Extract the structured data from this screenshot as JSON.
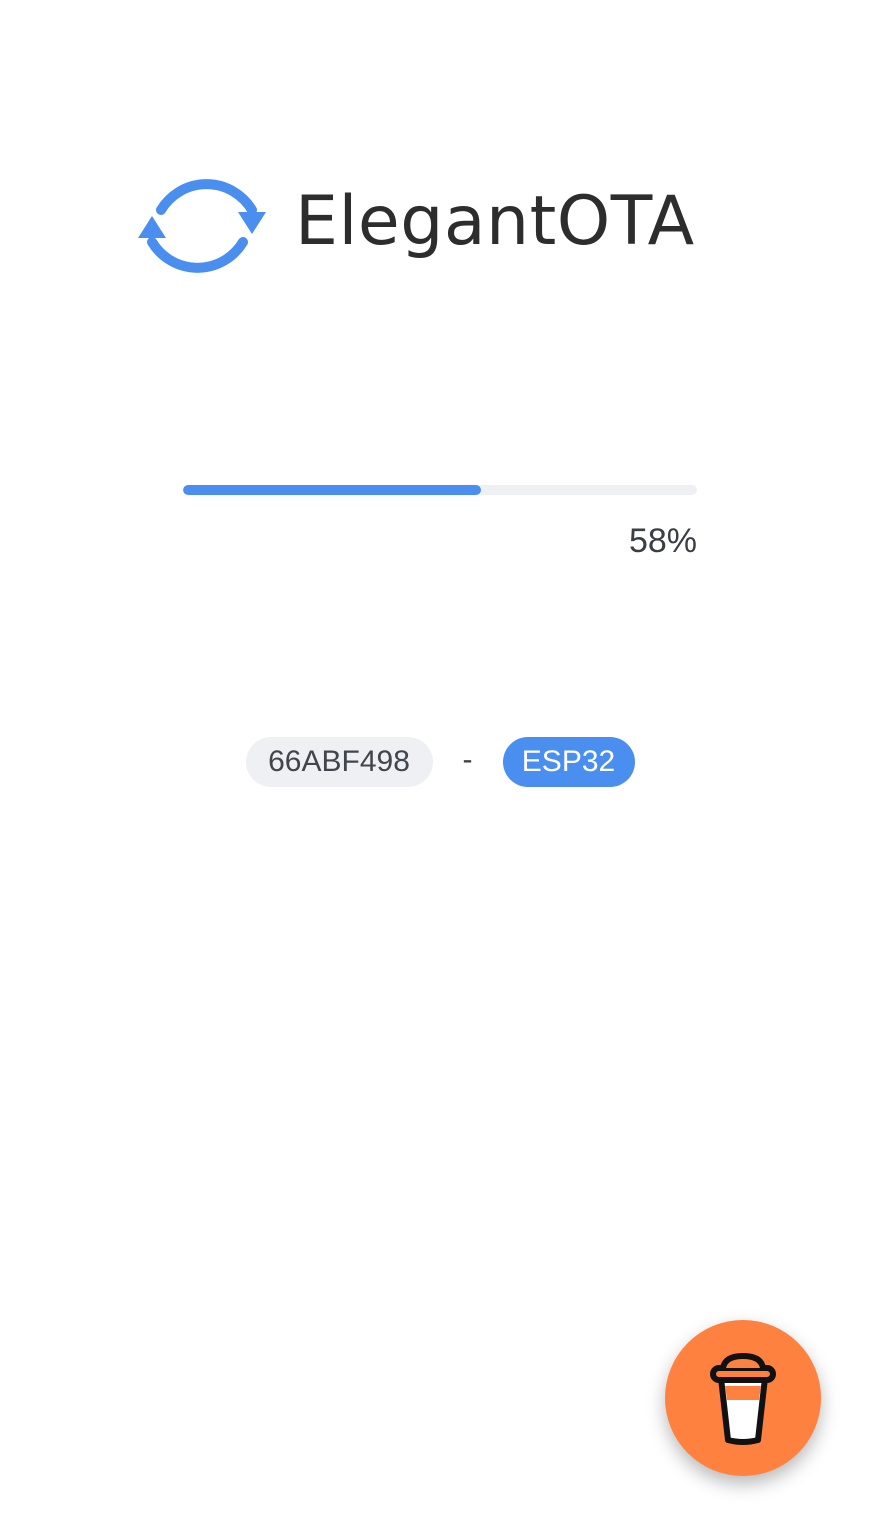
{
  "header": {
    "logo_icon": "sync-arrows-icon",
    "app_name": "ElegantOTA"
  },
  "progress": {
    "percent": 58,
    "label": "58%"
  },
  "device": {
    "id": "66ABF498",
    "separator": "-",
    "hardware": "ESP32"
  },
  "support": {
    "icon": "coffee-cup-icon"
  },
  "colors": {
    "accent": "#4a8ef0",
    "track": "#eef0f3",
    "support_button": "#ff813f",
    "text": "#2d2d2d"
  }
}
